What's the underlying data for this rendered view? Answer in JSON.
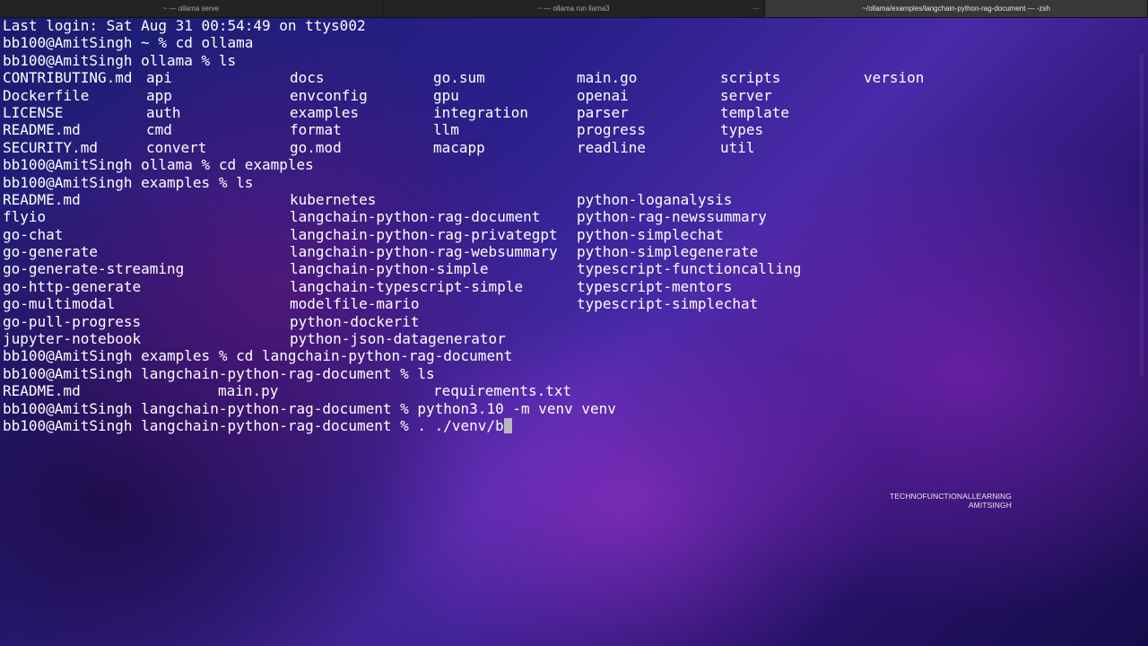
{
  "tabs": [
    {
      "title": "~ — ollama serve",
      "active": false
    },
    {
      "title": "~ — ollama run llama3",
      "active": false
    },
    {
      "title": "~/ollama/examples/langchain-python-rag-document — -zsh",
      "active": true
    }
  ],
  "tab_menu_glyph": "...",
  "terminal": {
    "lines": [
      {
        "text": "Last login: Sat Aug 31 00:54:49 on ttys002"
      },
      {
        "text": "bb100@AmitSingh ~ % cd ollama"
      },
      {
        "text": "bb100@AmitSingh ollama % ls"
      },
      {
        "cols": [
          "CONTRIBUTING.md",
          "api",
          "docs",
          "go.sum",
          "main.go",
          "scripts",
          "version"
        ]
      },
      {
        "cols": [
          "Dockerfile",
          "app",
          "envconfig",
          "gpu",
          "openai",
          "server",
          ""
        ]
      },
      {
        "cols": [
          "LICENSE",
          "auth",
          "examples",
          "integration",
          "parser",
          "template",
          ""
        ]
      },
      {
        "cols": [
          "README.md",
          "cmd",
          "format",
          "llm",
          "progress",
          "types",
          ""
        ]
      },
      {
        "cols": [
          "SECURITY.md",
          "convert",
          "go.mod",
          "macapp",
          "readline",
          "util",
          ""
        ]
      },
      {
        "text": "bb100@AmitSingh ollama % cd examples"
      },
      {
        "text": "bb100@AmitSingh examples % ls"
      },
      {
        "cols3": [
          "README.md",
          "kubernetes",
          "python-loganalysis"
        ]
      },
      {
        "cols3": [
          "flyio",
          "langchain-python-rag-document",
          "python-rag-newssummary"
        ]
      },
      {
        "cols3": [
          "go-chat",
          "langchain-python-rag-privategpt",
          "python-simplechat"
        ]
      },
      {
        "cols3": [
          "go-generate",
          "langchain-python-rag-websummary",
          "python-simplegenerate"
        ]
      },
      {
        "cols3": [
          "go-generate-streaming",
          "langchain-python-simple",
          "typescript-functioncalling"
        ]
      },
      {
        "cols3": [
          "go-http-generate",
          "langchain-typescript-simple",
          "typescript-mentors"
        ]
      },
      {
        "cols3": [
          "go-multimodal",
          "modelfile-mario",
          "typescript-simplechat"
        ]
      },
      {
        "cols3": [
          "go-pull-progress",
          "python-dockerit",
          ""
        ]
      },
      {
        "cols3": [
          "jupyter-notebook",
          "python-json-datagenerator",
          ""
        ]
      },
      {
        "text": "bb100@AmitSingh examples % cd langchain-python-rag-document"
      },
      {
        "text": "bb100@AmitSingh langchain-python-rag-document % ls"
      },
      {
        "files": [
          "README.md",
          "main.py",
          "requirements.txt"
        ]
      },
      {
        "text": "bb100@AmitSingh langchain-python-rag-document % python3.10 -m venv venv"
      },
      {
        "text": "bb100@AmitSingh langchain-python-rag-document % . ./venv/b",
        "cursor": true
      }
    ]
  },
  "watermark": {
    "line1": "TECHNOFUNCTIONALLEARNING",
    "line2": "AMITSINGH"
  },
  "colors": {
    "tabbar": "#232325",
    "tab_active": "#38383b",
    "text": "#ffffff",
    "cursor": "#b9b9b9"
  }
}
